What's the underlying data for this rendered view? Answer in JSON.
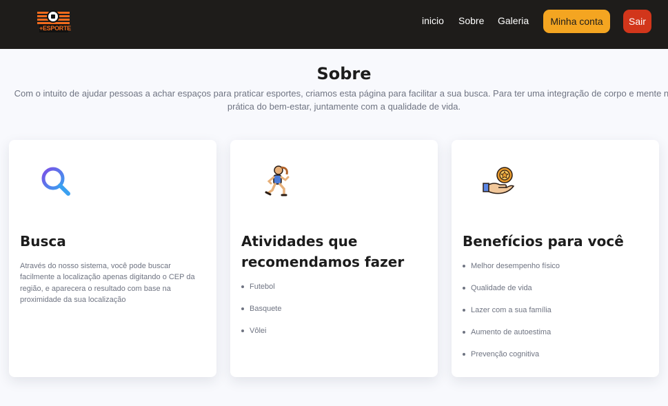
{
  "header": {
    "logo_text": "+ESPORTE",
    "nav": {
      "inicio": "inicio",
      "sobre": "Sobre",
      "galeria": "Galeria"
    },
    "account_button": "Minha conta",
    "logout_button": "Sair",
    "colors": {
      "background": "#1e1c1a",
      "account": "#f4a521",
      "logout": "#d2361b"
    }
  },
  "about": {
    "title": "Sobre",
    "intro": "Com o intuito de ajudar pessoas a achar espaços para praticar esportes, criamos esta página para facilitar a sua busca. Para ter uma integração de corpo e mente na prática do bem-estar, juntamente com a qualidade de vida."
  },
  "cards": [
    {
      "icon": "search-icon",
      "title": "Busca",
      "description": "Através do nosso sistema, você pode buscar facilmente a localização apenas digitando o CEP da região, e aparecera o resultado com base na proximidade da sua localização"
    },
    {
      "icon": "runner-icon",
      "title": "Atividades que recomendamos fazer",
      "items": [
        "Futebol",
        "Basquete",
        "Vôlei"
      ]
    },
    {
      "icon": "hand-medal-icon",
      "title": "Benefícios para você",
      "items": [
        "Melhor desempenho físico",
        "Qualidade de vida",
        "Lazer com a sua família",
        "Aumento de autoestima",
        "Prevenção cognitiva"
      ]
    }
  ]
}
